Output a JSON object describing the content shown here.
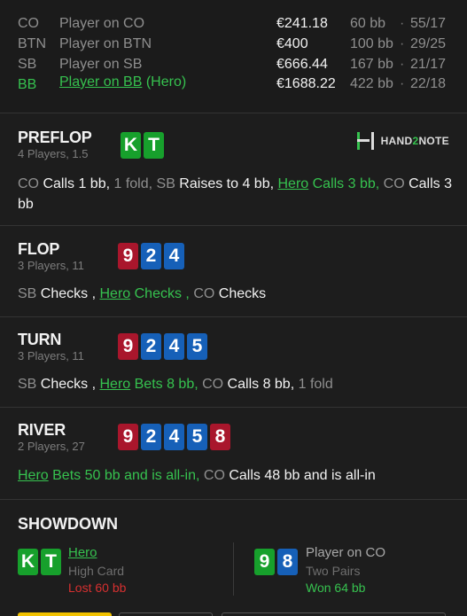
{
  "players": [
    {
      "pos": "CO",
      "name": "Player on CO",
      "suffix": "",
      "stack": "€241.18",
      "bb": "60 bb",
      "dot": "·",
      "ratio": "55/17",
      "hero": false
    },
    {
      "pos": "BTN",
      "name": "Player on BTN",
      "suffix": "",
      "stack": "€400",
      "bb": "100 bb",
      "dot": "·",
      "ratio": "29/25",
      "hero": false
    },
    {
      "pos": "SB",
      "name": "Player on SB",
      "suffix": "",
      "stack": "€666.44",
      "bb": "167 bb",
      "dot": "·",
      "ratio": "21/17",
      "hero": false
    },
    {
      "pos": "BB",
      "name": "Player on BB",
      "suffix": " (Hero)",
      "stack": "€1688.22",
      "bb": "422 bb",
      "dot": "·",
      "ratio": "22/18",
      "hero": true
    }
  ],
  "logo": {
    "text_a": "HAND",
    "text_b": "2",
    "text_c": "NOTE"
  },
  "preflop": {
    "name": "PREFLOP",
    "sub": "4 Players, 1.5",
    "cards": [
      {
        "rank": "K",
        "color": "#17a02c"
      },
      {
        "rank": "T",
        "color": "#17a02c"
      }
    ],
    "a1": "CO",
    "a2": " Calls 1 bb, ",
    "a3": "1 fold, ",
    "a4": "SB",
    "a5": " Raises to 4 bb, ",
    "a6": "Hero",
    "a7": " Calls 3 bb, ",
    "a8": "CO",
    "a9": " Calls 3 bb"
  },
  "flop": {
    "name": "FLOP",
    "sub": "3 Players, 11",
    "cards": [
      {
        "rank": "9",
        "color": "#a9162c"
      },
      {
        "rank": "2",
        "color": "#1660b8"
      },
      {
        "rank": "4",
        "color": "#1660b8"
      }
    ],
    "a1": "SB",
    "a2": " Checks , ",
    "a3": "Hero",
    "a4": " Checks , ",
    "a5": "CO",
    "a6": " Checks"
  },
  "turn": {
    "name": "TURN",
    "sub": "3 Players, 11",
    "cards": [
      {
        "rank": "9",
        "color": "#a9162c"
      },
      {
        "rank": "2",
        "color": "#1660b8"
      },
      {
        "rank": "4",
        "color": "#1660b8"
      },
      {
        "rank": "5",
        "color": "#1660b8"
      }
    ],
    "a1": "SB",
    "a2": " Checks , ",
    "a3": "Hero",
    "a4": " Bets 8 bb, ",
    "a5": "CO",
    "a6": " Calls 8 bb, ",
    "a7": "1 fold"
  },
  "river": {
    "name": "RIVER",
    "sub": "2 Players, 27",
    "cards": [
      {
        "rank": "9",
        "color": "#a9162c"
      },
      {
        "rank": "2",
        "color": "#1660b8"
      },
      {
        "rank": "4",
        "color": "#1660b8"
      },
      {
        "rank": "5",
        "color": "#1660b8"
      },
      {
        "rank": "8",
        "color": "#a9162c"
      }
    ],
    "a1": "Hero",
    "a2": " Bets 50 bb and is all-in, ",
    "a3": "CO",
    "a4": " Calls 48 bb and is all-in"
  },
  "showdown": {
    "title": "SHOWDOWN",
    "hero": {
      "cards": [
        {
          "rank": "K",
          "color": "#17a02c"
        },
        {
          "rank": "T",
          "color": "#17a02c"
        }
      ],
      "name": "Hero",
      "hand": "High Card",
      "result": "Lost 60 bb",
      "result_color": "#d63030"
    },
    "villain": {
      "cards": [
        {
          "rank": "9",
          "color": "#17a02c"
        },
        {
          "rank": "8",
          "color": "#1660b8"
        }
      ],
      "name": "Player on CO",
      "hand": "Two Pairs",
      "result": "Won 64 bb",
      "result_color": "#36c24f"
    }
  },
  "colors": {
    "accent_green": "#36c24f",
    "bg": "#1d1d1d",
    "tab_active": "#f2c200"
  }
}
